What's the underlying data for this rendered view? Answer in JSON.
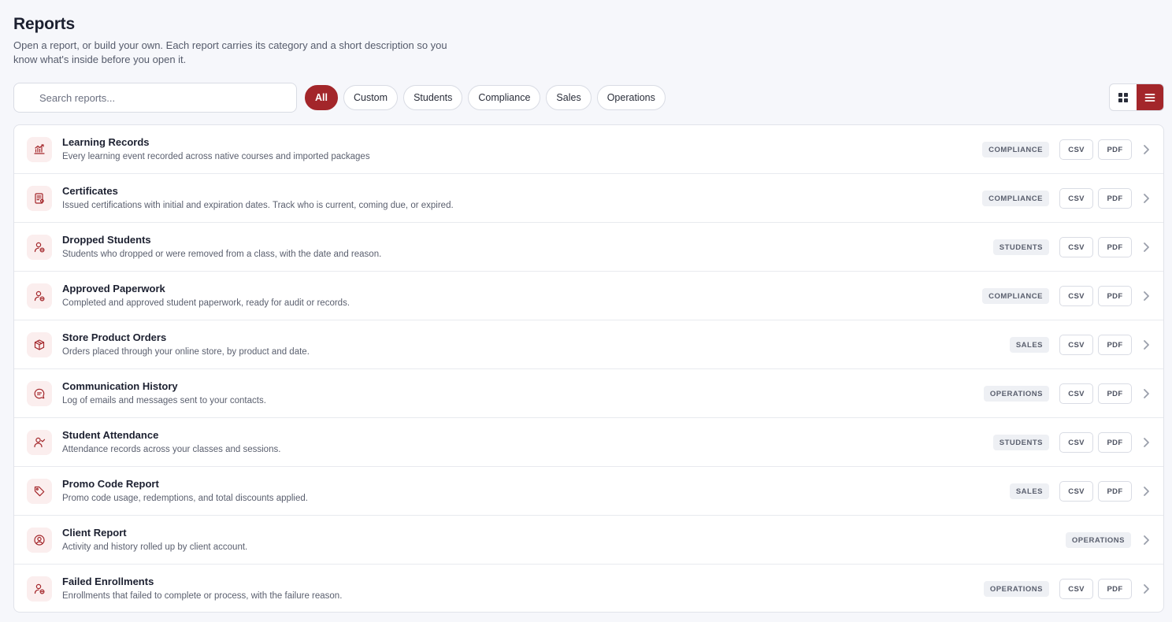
{
  "header": {
    "title": "Reports",
    "subtitle": "Open a report, or build your own. Each report carries its category and a short description so you know what's inside before you open it."
  },
  "search": {
    "placeholder": "Search reports...",
    "value": ""
  },
  "filters": [
    {
      "label": "All",
      "active": true
    },
    {
      "label": "Custom",
      "active": false
    },
    {
      "label": "Students",
      "active": false
    },
    {
      "label": "Compliance",
      "active": false
    },
    {
      "label": "Sales",
      "active": false
    },
    {
      "label": "Operations",
      "active": false
    }
  ],
  "view": {
    "grid_icon": "grid-icon",
    "list_icon": "list-icon",
    "active": "list"
  },
  "export_labels": {
    "csv": "CSV",
    "pdf": "PDF"
  },
  "colors": {
    "accent": "#a3262a",
    "icon_bg": "#fbeeee"
  },
  "reports": [
    {
      "title": "Learning Records",
      "desc": "Every learning event recorded across native courses and imported packages",
      "category": "COMPLIANCE",
      "icon": "chart-icon",
      "exports": true
    },
    {
      "title": "Certificates",
      "desc": "Issued certifications with initial and expiration dates. Track who is current, coming due, or expired.",
      "category": "COMPLIANCE",
      "icon": "certificate-icon",
      "exports": true
    },
    {
      "title": "Dropped Students",
      "desc": "Students who dropped or were removed from a class, with the date and reason.",
      "category": "STUDENTS",
      "icon": "user-x-icon",
      "exports": true
    },
    {
      "title": "Approved Paperwork",
      "desc": "Completed and approved student paperwork, ready for audit or records.",
      "category": "COMPLIANCE",
      "icon": "user-x-icon",
      "exports": true
    },
    {
      "title": "Store Product Orders",
      "desc": "Orders placed through your online store, by product and date.",
      "category": "SALES",
      "icon": "package-icon",
      "exports": true
    },
    {
      "title": "Communication History",
      "desc": "Log of emails and messages sent to your contacts.",
      "category": "OPERATIONS",
      "icon": "message-icon",
      "exports": true
    },
    {
      "title": "Student Attendance",
      "desc": "Attendance records across your classes and sessions.",
      "category": "STUDENTS",
      "icon": "user-check-icon",
      "exports": true
    },
    {
      "title": "Promo Code Report",
      "desc": "Promo code usage, redemptions, and total discounts applied.",
      "category": "SALES",
      "icon": "tag-icon",
      "exports": true
    },
    {
      "title": "Client Report",
      "desc": "Activity and history rolled up by client account.",
      "category": "OPERATIONS",
      "icon": "user-circle-icon",
      "exports": false
    },
    {
      "title": "Failed Enrollments",
      "desc": "Enrollments that failed to complete or process, with the failure reason.",
      "category": "OPERATIONS",
      "icon": "user-x-icon",
      "exports": true
    }
  ]
}
